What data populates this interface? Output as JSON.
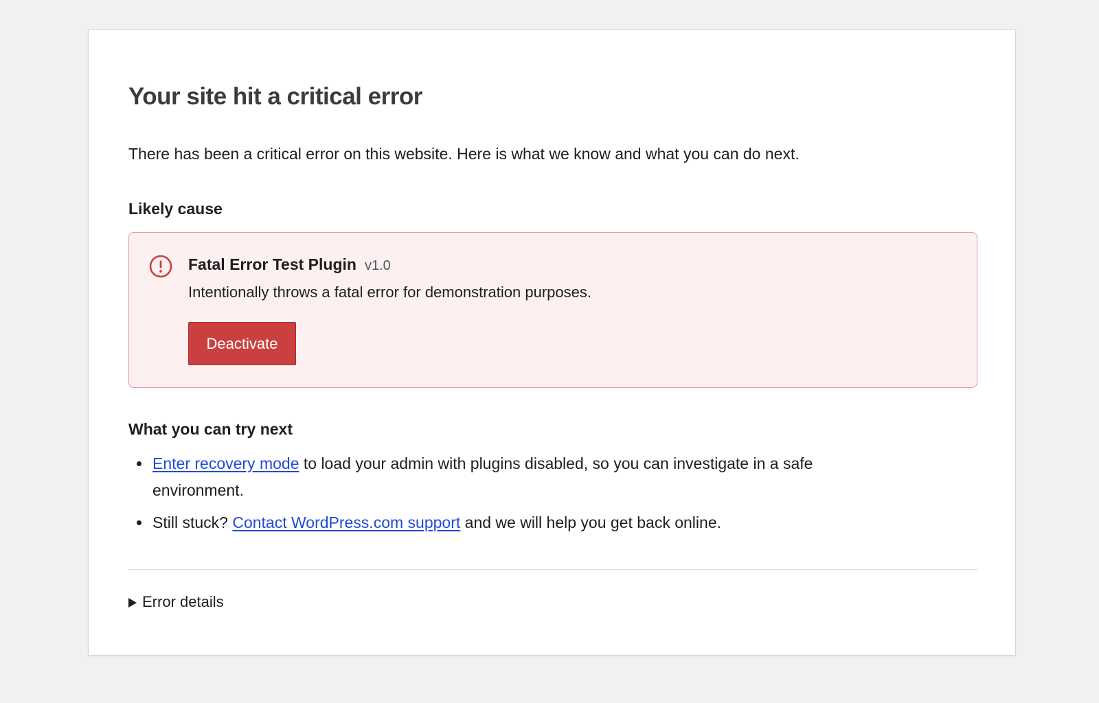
{
  "page": {
    "title": "Your site hit a critical error",
    "intro": "There has been a critical error on this website. Here is what we know and what you can do next."
  },
  "likely_cause": {
    "heading": "Likely cause",
    "icon": "alert-circle-icon",
    "plugin_name": "Fatal Error Test Plugin",
    "plugin_version": "v1.0",
    "plugin_description": "Intentionally throws a fatal error for demonstration purposes.",
    "deactivate_label": "Deactivate"
  },
  "next_steps": {
    "heading": "What you can try next",
    "items": [
      {
        "link_text": "Enter recovery mode",
        "text_after": " to load your admin with plugins disabled, so you can investigate in a safe environment."
      },
      {
        "text_before": "Still stuck? ",
        "link_text": "Contact WordPress.com support",
        "text_after": " and we will help you get back online."
      }
    ]
  },
  "details": {
    "label": "Error details"
  },
  "colors": {
    "background": "#f1f1f1",
    "card": "#ffffff",
    "cause_box_background": "#fcf0f1",
    "cause_box_border": "#e49a9e",
    "error_red": "#c9403f",
    "link": "#2249d8"
  }
}
